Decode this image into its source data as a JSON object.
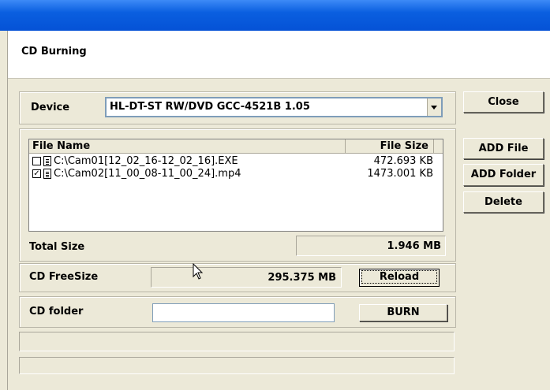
{
  "window": {
    "header_title": "CD Burning"
  },
  "device": {
    "label": "Device",
    "selected": "HL-DT-ST RW/DVD GCC-4521B 1.05"
  },
  "files": {
    "columns": {
      "name": "File Name",
      "size": "File Size"
    },
    "rows": [
      {
        "checked": false,
        "name": "C:\\Cam01[12_02_16-12_02_16].EXE",
        "size": "472.693 KB"
      },
      {
        "checked": true,
        "name": "C:\\Cam02[11_00_08-11_00_24].mp4",
        "size": "1473.001 KB"
      }
    ],
    "total_label": "Total Size",
    "total_value": "1.946 MB"
  },
  "free": {
    "label": "CD FreeSize",
    "value": "295.375 MB",
    "reload_label": "Reload"
  },
  "folder": {
    "label": "CD folder",
    "value": "",
    "burn_label": "BURN"
  },
  "side_buttons": {
    "close": "Close",
    "add_file": "ADD File",
    "add_folder": "ADD Folder",
    "delete": "Delete"
  }
}
